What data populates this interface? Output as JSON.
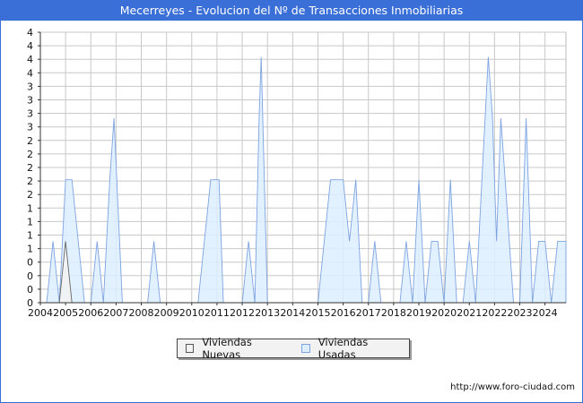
{
  "chart_data": {
    "type": "area",
    "title": "Mecerreyes - Evolucion del Nº de Transacciones Inmobiliarias",
    "xlabel": "",
    "ylabel": "",
    "x_ticks": [
      "2004",
      "2005",
      "2006",
      "2007",
      "2008",
      "2009",
      "2010",
      "2011",
      "2012",
      "2013",
      "2014",
      "2015",
      "2016",
      "2017",
      "2018",
      "2019",
      "2020",
      "2021",
      "2022",
      "2023",
      "2024"
    ],
    "y_tick_labels": [
      "0",
      "0",
      "0",
      "0",
      "1",
      "1",
      "1",
      "1",
      "2",
      "2",
      "2",
      "2",
      "2",
      "3",
      "3",
      "3",
      "3",
      "4",
      "4",
      "4",
      "4"
    ],
    "ylim": [
      0,
      4.4
    ],
    "xlim": [
      2004.0,
      2024.83
    ],
    "grid": true,
    "legend_position": "bottom",
    "series": [
      {
        "name": "Viviendas Nuevas",
        "color": "#f2f2f2",
        "stroke": "#666666",
        "points": [
          [
            2004.0,
            0
          ],
          [
            2004.75,
            0
          ],
          [
            2005.0,
            1
          ],
          [
            2005.25,
            0
          ],
          [
            2024.83,
            0
          ]
        ]
      },
      {
        "name": "Viviendas Usadas",
        "color": "#ddeeff",
        "stroke": "#7ea3e0",
        "points": [
          [
            2004.0,
            0
          ],
          [
            2004.25,
            0
          ],
          [
            2004.5,
            1
          ],
          [
            2004.75,
            0
          ],
          [
            2005.0,
            2
          ],
          [
            2005.25,
            2
          ],
          [
            2005.75,
            0
          ],
          [
            2006.0,
            0
          ],
          [
            2006.25,
            1
          ],
          [
            2006.5,
            0
          ],
          [
            2006.75,
            2
          ],
          [
            2006.92,
            3
          ],
          [
            2007.25,
            0
          ],
          [
            2008.25,
            0
          ],
          [
            2008.5,
            1
          ],
          [
            2008.75,
            0
          ],
          [
            2010.25,
            0
          ],
          [
            2010.75,
            2
          ],
          [
            2010.92,
            2
          ],
          [
            2011.08,
            2
          ],
          [
            2011.25,
            0
          ],
          [
            2012.0,
            0
          ],
          [
            2012.25,
            1
          ],
          [
            2012.5,
            0
          ],
          [
            2012.67,
            3
          ],
          [
            2012.75,
            4
          ],
          [
            2013.0,
            0
          ],
          [
            2015.0,
            0
          ],
          [
            2015.5,
            2
          ],
          [
            2015.75,
            2
          ],
          [
            2016.0,
            2
          ],
          [
            2016.25,
            1
          ],
          [
            2016.5,
            2
          ],
          [
            2016.75,
            0
          ],
          [
            2017.0,
            0
          ],
          [
            2017.25,
            1
          ],
          [
            2017.5,
            0
          ],
          [
            2018.25,
            0
          ],
          [
            2018.5,
            1
          ],
          [
            2018.75,
            0
          ],
          [
            2019.0,
            2
          ],
          [
            2019.25,
            0
          ],
          [
            2019.5,
            1
          ],
          [
            2019.75,
            1
          ],
          [
            2020.0,
            0
          ],
          [
            2020.25,
            2
          ],
          [
            2020.5,
            0
          ],
          [
            2020.75,
            0
          ],
          [
            2021.0,
            1
          ],
          [
            2021.25,
            0
          ],
          [
            2021.5,
            2
          ],
          [
            2021.75,
            4
          ],
          [
            2021.92,
            3
          ],
          [
            2022.08,
            1
          ],
          [
            2022.25,
            3
          ],
          [
            2022.42,
            2
          ],
          [
            2022.75,
            0
          ],
          [
            2023.0,
            0
          ],
          [
            2023.25,
            3
          ],
          [
            2023.5,
            0
          ],
          [
            2023.75,
            1
          ],
          [
            2024.0,
            1
          ],
          [
            2024.25,
            0
          ],
          [
            2024.5,
            1
          ],
          [
            2024.83,
            1
          ]
        ]
      }
    ]
  },
  "footer": {
    "url": "http://www.foro-ciudad.com"
  }
}
